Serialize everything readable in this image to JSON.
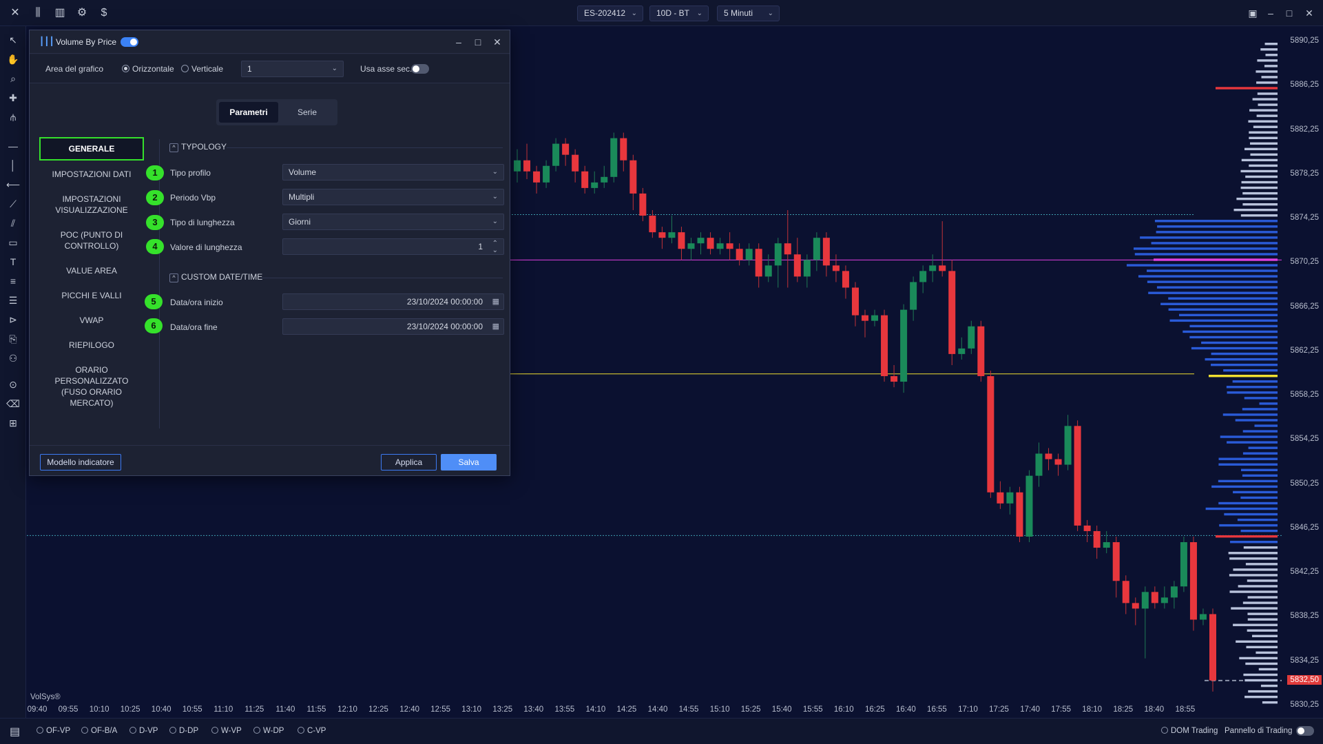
{
  "topbar": {
    "symbol": "ES-202412",
    "period": "10D - BT",
    "timeframe": "5 Minuti"
  },
  "chart": {
    "brand": "VolSys®",
    "current_price": "5832,50",
    "price_ticks": [
      "5890,25",
      "5886,25",
      "5882,25",
      "5878,25",
      "5874,25",
      "5870,25",
      "5866,25",
      "5862,25",
      "5858,25",
      "5854,25",
      "5850,25",
      "5846,25",
      "5842,25",
      "5838,25",
      "5834,25",
      "5830,25"
    ],
    "time_ticks": [
      "09:40",
      "09:55",
      "10:10",
      "10:25",
      "10:40",
      "10:55",
      "11:10",
      "11:25",
      "11:40",
      "11:55",
      "12:10",
      "12:25",
      "12:40",
      "12:55",
      "13:10",
      "13:25",
      "13:40",
      "13:55",
      "14:10",
      "14:25",
      "14:40",
      "14:55",
      "15:10",
      "15:25",
      "15:40",
      "15:55",
      "16:10",
      "16:25",
      "16:40",
      "16:55",
      "17:10",
      "17:25",
      "17:40",
      "17:55",
      "18:10",
      "18:25",
      "18:40",
      "18:55"
    ],
    "colors": {
      "up": "#1a8a5a",
      "down": "#e8373d",
      "profile": "#2a5bd8",
      "poc": "#e040e0",
      "vah": "#f2e030"
    }
  },
  "bottombar": {
    "modes": [
      "OF-VP",
      "OF-B/A",
      "D-VP",
      "D-DP",
      "W-VP",
      "W-DP",
      "C-VP"
    ],
    "dom_trading": "DOM Trading",
    "trading_panel": "Pannello di Trading"
  },
  "dialog": {
    "title": "Volume By Price",
    "area_label": "Area del grafico",
    "orient_h": "Orizzontale",
    "orient_v": "Verticale",
    "area_value": "1",
    "secondary_axis": "Usa asse sec.",
    "tabs": [
      "Parametri",
      "Serie"
    ],
    "nav": [
      "GENERALE",
      "IMPOSTAZIONI DATI",
      "IMPOSTAZIONI VISUALIZZAZIONE",
      "POC (PUNTO DI CONTROLLO)",
      "VALUE AREA",
      "PICCHI E VALLI",
      "VWAP",
      "RIEPILOGO",
      "ORARIO PERSONALIZZATO (FUSO ORARIO MERCATO)"
    ],
    "section_typology": "TYPOLOGY",
    "section_custom": "CUSTOM DATE/TIME",
    "fields": [
      {
        "badge": "1",
        "label": "Tipo profilo",
        "value": "Volume"
      },
      {
        "badge": "2",
        "label": "Periodo Vbp",
        "value": "Multipli"
      },
      {
        "badge": "3",
        "label": "Tipo di lunghezza",
        "value": "Giorni"
      },
      {
        "badge": "4",
        "label": "Valore di lunghezza",
        "value": "1"
      },
      {
        "badge": "5",
        "label": "Data/ora inizio",
        "value": "23/10/2024 00:00:00"
      },
      {
        "badge": "6",
        "label": "Data/ora fine",
        "value": "23/10/2024 00:00:00"
      }
    ],
    "btn_model": "Modello indicatore",
    "btn_apply": "Applica",
    "btn_save": "Salva"
  }
}
